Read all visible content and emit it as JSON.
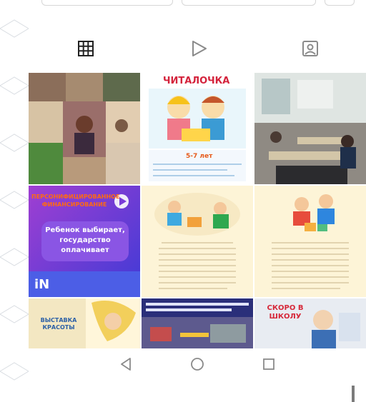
{
  "profile_tabs": {
    "grid": {
      "icon": "grid-icon",
      "active": true
    },
    "reels": {
      "icon": "play-icon"
    },
    "tagged": {
      "icon": "tagged-person-icon"
    }
  },
  "posts": [
    {
      "label": ""
    },
    {
      "label": "ЧИТАЛОЧКА",
      "sub": "5-7 лет"
    },
    {
      "label": ""
    },
    {
      "label": "ПЕРСОНИФИЦИРОВАННОЕ ФИНАНСИРОВАНИЕ",
      "body": "Ребенок выбирает, государство оплачивает",
      "logo": "iN"
    },
    {
      "label": ""
    },
    {
      "label": ""
    },
    {
      "label": "ВЫСТАВКА КРАСОТЫ"
    },
    {
      "label": ""
    },
    {
      "label": "СКОРО В ШКОЛУ"
    }
  ],
  "colors": {
    "accent": "#ff6a13",
    "purple": "#7a3bd8",
    "cream": "#fdf4d7"
  },
  "system_nav": {
    "back": "back-triangle-icon",
    "home": "home-circle-icon",
    "recents": "recents-square-icon"
  }
}
